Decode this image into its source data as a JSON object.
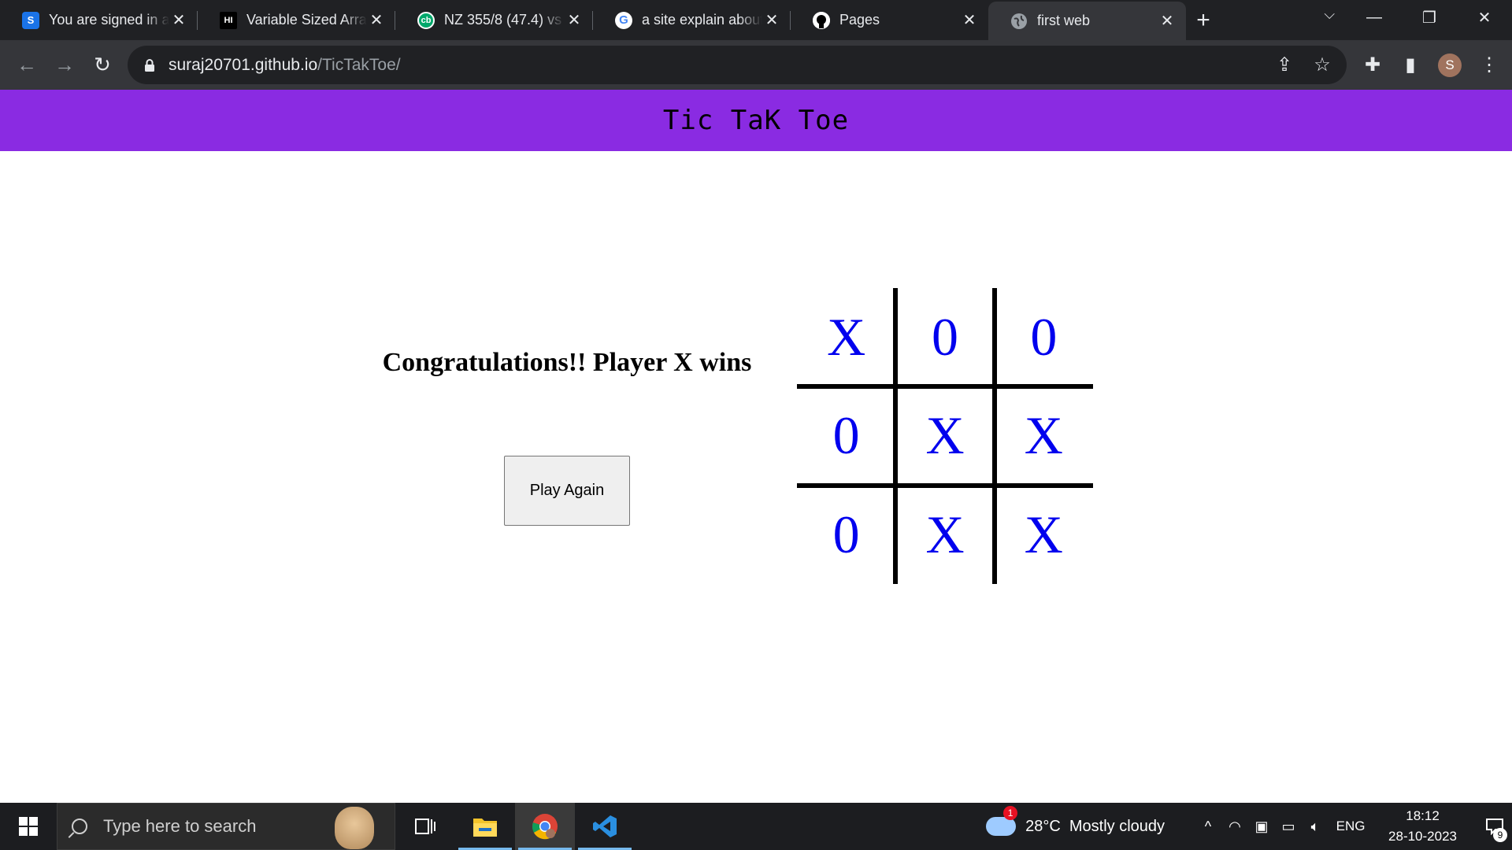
{
  "browser": {
    "tabs": [
      {
        "title": "You are signed in as",
        "favicon": "S",
        "favicon_color": "#1a73e8",
        "active": false
      },
      {
        "title": "Variable Sized Arrays",
        "favicon": "HI",
        "favicon_color": "#000000",
        "active": false
      },
      {
        "title": "NZ 355/8 (47.4) vs",
        "favicon": "cb",
        "favicon_color": "#00a86b",
        "active": false
      },
      {
        "title": "a site explain about",
        "favicon": "G",
        "favicon_color": "#ffffff",
        "active": false
      },
      {
        "title": "Pages",
        "favicon": "github",
        "favicon_color": "#ffffff",
        "active": false
      },
      {
        "title": "first web",
        "favicon": "globe",
        "favicon_color": "#9aa0a6",
        "active": true
      }
    ],
    "url_host": "suraj20701.github.io",
    "url_path": "/TicTakToe/",
    "profile_initial": "S"
  },
  "page": {
    "header_title": "Tic TaK Toe",
    "header_color": "#8a2be2",
    "result_message": "Congratulations!! Player X wins",
    "play_again_label": "Play Again",
    "board": [
      "X",
      "0",
      "0",
      "0",
      "X",
      "X",
      "0",
      "X",
      "X"
    ],
    "mark_color": "#0000ee"
  },
  "taskbar": {
    "search_placeholder": "Type here to search",
    "weather_badge": "1",
    "weather": "28°C  Mostly cloudy",
    "language": "ENG",
    "time": "18:12",
    "date": "28-10-2023",
    "notification_count": "9"
  }
}
